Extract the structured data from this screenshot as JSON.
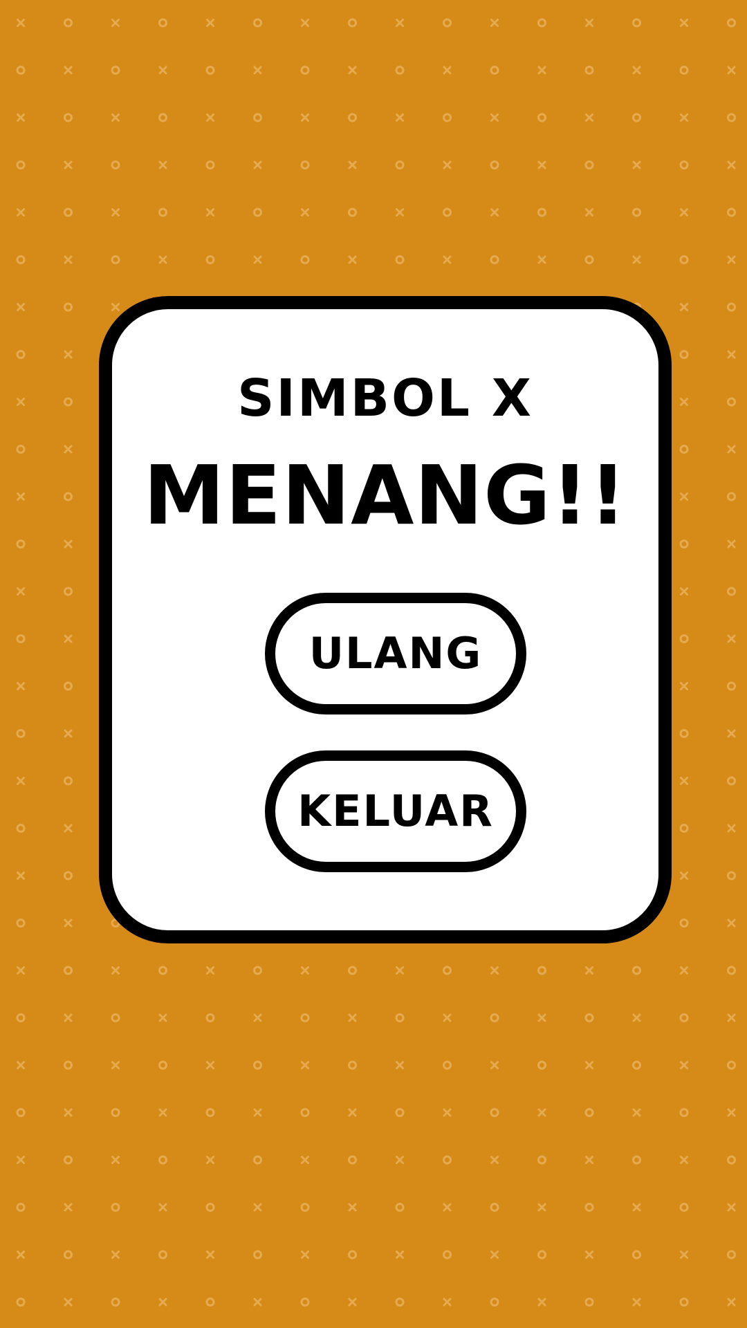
{
  "theme": {
    "background": "#D68B18",
    "pattern": "#E6AA50",
    "panel": "#FFFFFF",
    "outline": "#000000"
  },
  "background_pattern": {
    "symbols": [
      "x",
      "o"
    ]
  },
  "dialog": {
    "subtitle": "SIMBOL X",
    "title": "MENANG!!",
    "buttons": {
      "restart_label": "ULANG",
      "exit_label": "KELUAR"
    }
  }
}
